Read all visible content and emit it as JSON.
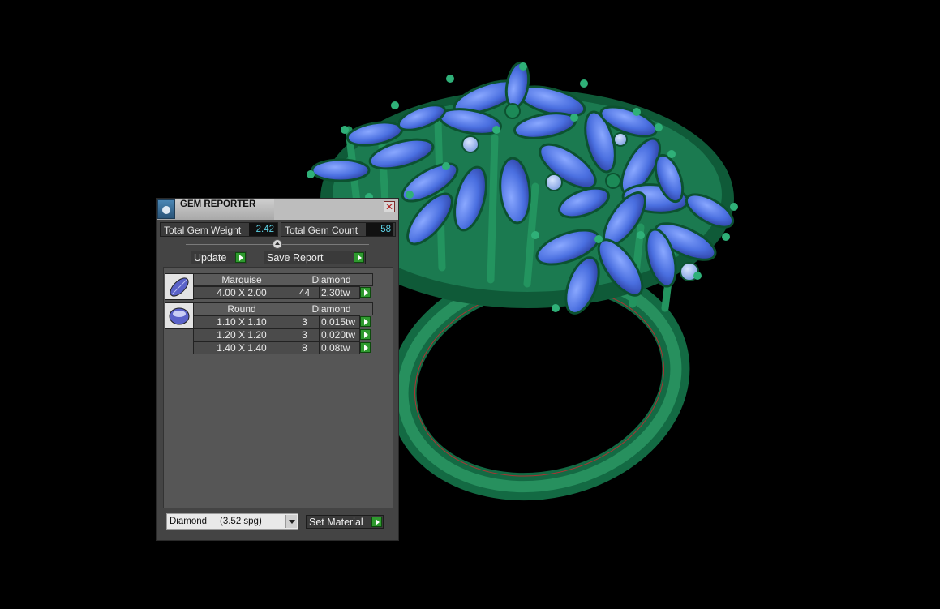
{
  "panel": {
    "title": "GEM REPORTER",
    "close_glyph": "✕",
    "total_weight_label": "Total Gem Weight",
    "total_weight_value": "2.42",
    "total_count_label": "Total Gem Count",
    "total_count_value": "58",
    "update_label": "Update",
    "save_report_label": "Save Report"
  },
  "gem_groups": [
    {
      "shape": "Marquise",
      "icon": "marquise-gem-icon",
      "material": "Diamond",
      "rows": [
        {
          "size": "4.00 X 2.00",
          "count": "44",
          "weight": "2.30tw"
        }
      ]
    },
    {
      "shape": "Round",
      "icon": "round-gem-icon",
      "material": "Diamond",
      "rows": [
        {
          "size": "1.10 X 1.10",
          "count": "3",
          "weight": "0.015tw"
        },
        {
          "size": "1.20 X 1.20",
          "count": "3",
          "weight": "0.020tw"
        },
        {
          "size": "1.40 X 1.40",
          "count": "8",
          "weight": "0.08tw"
        }
      ]
    }
  ],
  "footer": {
    "material_select_value": "Diamond     (3.52 spg)",
    "set_material_label": "Set Material"
  },
  "colors": {
    "metal": "#1e7a52",
    "gem": "#4a6fe0",
    "accent_play": "#2f9a2f",
    "value_text": "#5ed3e6"
  }
}
